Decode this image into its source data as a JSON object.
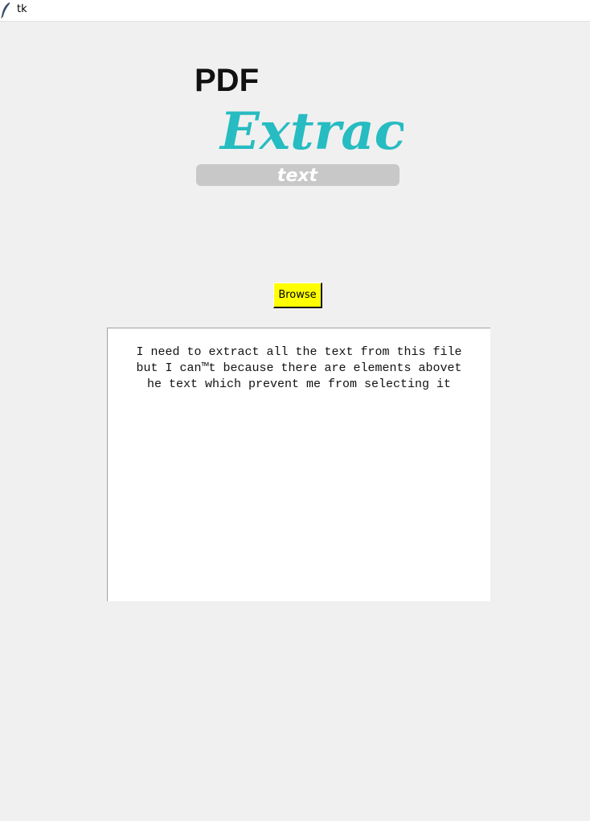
{
  "window": {
    "title": "tk",
    "icon": "feather-icon"
  },
  "logo": {
    "line1": "PDF",
    "line2": "Extract",
    "line3": "text",
    "colors": {
      "line1": "#111111",
      "line2": "#26bcc1",
      "bar": "#c8c8c8",
      "line3": "#ffffff"
    }
  },
  "toolbar": {
    "browse_label": "Browse",
    "browse_color": "#ffff00"
  },
  "output": {
    "lines": [
      "I need to extract all the text from this file",
      "but I can™t because there are elements abovet",
      "he text which prevent me from selecting it"
    ]
  }
}
